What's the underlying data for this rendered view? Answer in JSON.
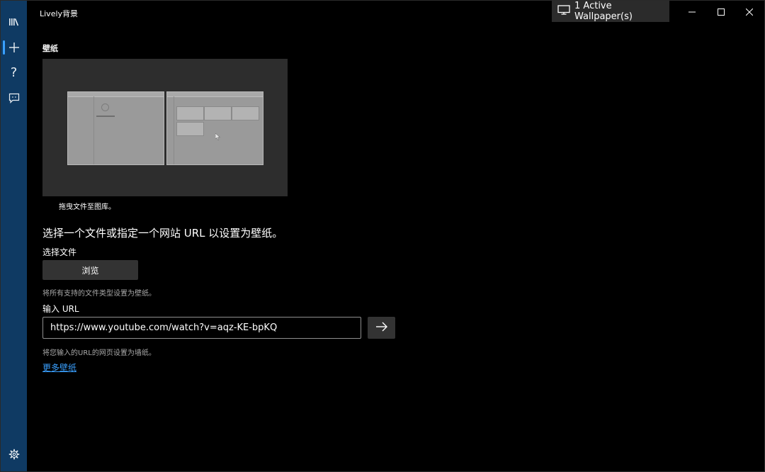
{
  "window": {
    "title": "Lively背景",
    "active_wallpaper_label": "1 Active Wallpaper(s)"
  },
  "sidebar": {
    "items": [
      {
        "icon": "library-icon"
      },
      {
        "icon": "add-icon",
        "glyph": "+"
      },
      {
        "icon": "help-icon",
        "glyph": "?"
      },
      {
        "icon": "feedback-icon"
      },
      {
        "icon": "settings-icon"
      }
    ]
  },
  "content": {
    "section_heading": "壁纸",
    "drop_hint": "拖曳文件至图库。",
    "instruction": "选择一个文件或指定一个网站 URL 以设置为壁纸。",
    "file": {
      "label": "选择文件",
      "browse_label": "浏览",
      "hint": "将所有支持的文件类型设置为壁纸。"
    },
    "url": {
      "label": "输入 URL",
      "value": "https://www.youtube.com/watch?v=aqz-KE-bpKQ",
      "hint": "将您输入的URL的网页设置为墙纸。"
    },
    "more_link": "更多壁纸"
  },
  "colors": {
    "sidebar": "#0f3a63",
    "background": "#000000",
    "accent": "#3aa0ff",
    "button": "#333333"
  }
}
